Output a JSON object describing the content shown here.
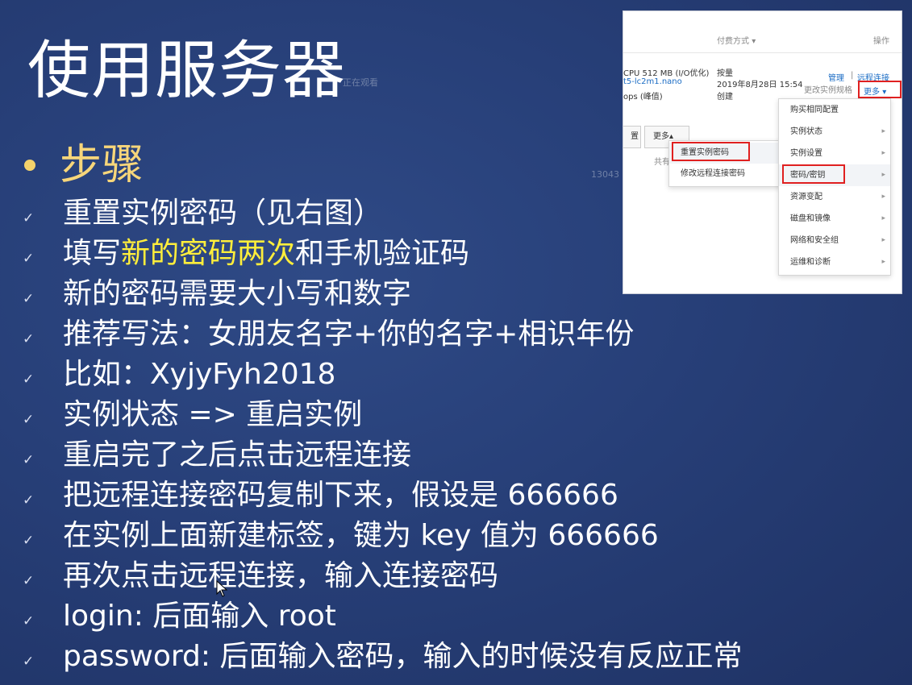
{
  "slide": {
    "title": "使用服务器",
    "watermark": "正在观看",
    "watermark2": "13043",
    "heading": "步骤",
    "steps": [
      {
        "text": "重置实例密码（见右图）"
      },
      {
        "pre": "填写",
        "highlight": "新的密码两次",
        "post": "和手机验证码"
      },
      {
        "text": "新的密码需要大小写和数字"
      },
      {
        "text": "推荐写法：女朋友名字+你的名字+相识年份"
      },
      {
        "text": "比如：XyjyFyh2018"
      },
      {
        "text": "实例状态 => 重启实例"
      },
      {
        "text": "重启完了之后点击远程连接"
      },
      {
        "text": "把远程连接密码复制下来，假设是 666666"
      },
      {
        "text": "在实例上面新建标签，键为 key 值为 666666"
      },
      {
        "text": "再次点击远程连接，输入连接密码"
      },
      {
        "text": "login: 后面输入 root"
      },
      {
        "text": "password: 后面输入密码，输入的时候没有反应正常"
      }
    ],
    "check_glyph": "✓"
  },
  "screenshot": {
    "col_payment": "付费方式",
    "col_actions": "操作",
    "spec_line1": "CPU 512 MB (I/O优化)",
    "spec_line2": "t5-lc2m1.nano",
    "spec_line3": "ops (峰值)",
    "billing": "按量",
    "created_time": "2019年8月28日 15:54",
    "created_label": "创建",
    "manage": "管理",
    "remote": "远程连接",
    "change_spec": "更改实例规格",
    "more": "更多",
    "more_btn2": "更多",
    "left_btn": "置",
    "shared": "共有",
    "menu_items": [
      {
        "label": "购买相同配置",
        "arrow": ""
      },
      {
        "label": "实例状态",
        "arrow": "▸"
      },
      {
        "label": "实例设置",
        "arrow": "▸"
      },
      {
        "label": "密码/密钥",
        "arrow": "▸"
      },
      {
        "label": "资源变配",
        "arrow": "▸"
      },
      {
        "label": "磁盘和镜像",
        "arrow": "▸"
      },
      {
        "label": "网络和安全组",
        "arrow": "▸"
      },
      {
        "label": "运维和诊断",
        "arrow": "▸"
      }
    ],
    "submenu_items": [
      {
        "label": "重置实例密码"
      },
      {
        "label": "修改远程连接密码"
      }
    ],
    "colors": {
      "highlight_red": "#e02020",
      "link_blue": "#1b6cc4"
    }
  }
}
